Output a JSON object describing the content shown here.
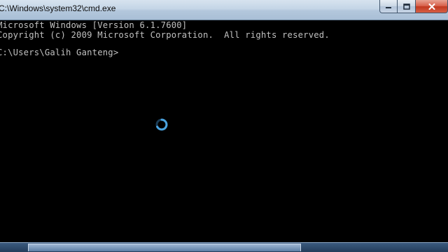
{
  "window": {
    "title": "C:\\Windows\\system32\\cmd.exe",
    "icons": {
      "minimize": "minimize-icon",
      "maximize": "maximize-icon",
      "close": "close-icon"
    }
  },
  "console": {
    "lines": [
      "Microsoft Windows [Version 6.1.7600]",
      "Copyright (c) 2009 Microsoft Corporation.  All rights reserved.",
      "C:\\Users\\Galih Ganteng>"
    ]
  },
  "cursor": {
    "icon": "busy-spinner-icon"
  },
  "colors": {
    "console_background": "#000000",
    "console_text": "#c0c0c0",
    "titlebar": "#c4d5e6",
    "close_button": "#c0381f",
    "spinner": "#4aa3df"
  }
}
